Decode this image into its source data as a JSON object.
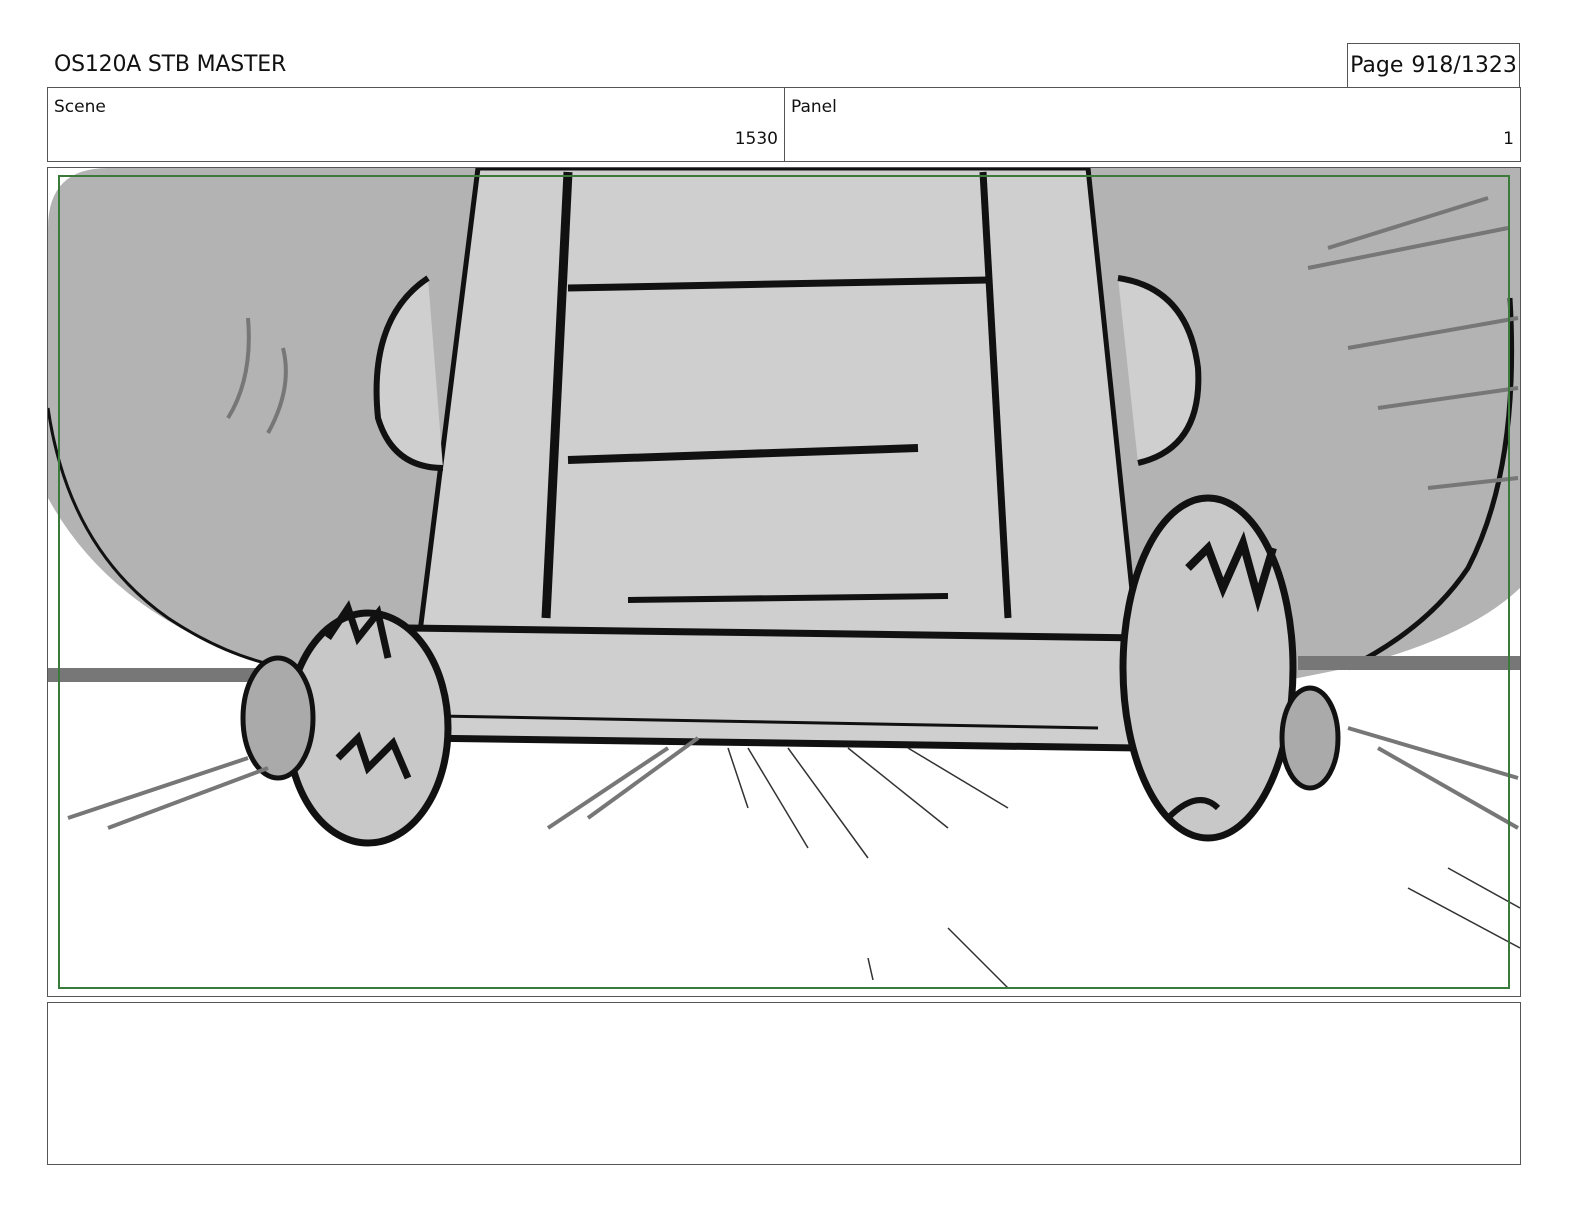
{
  "header": {
    "title": "OS120A STB MASTER",
    "page_label": "Page",
    "page_number": "918/1323"
  },
  "info": {
    "scene_label": "Scene",
    "scene_value": "1530",
    "panel_label": "Panel",
    "panel_value": "1"
  },
  "drawing": {
    "description_icon": "storyboard-sketch",
    "safe_frame_color": "#3a7a3a"
  },
  "notes": {
    "text": ""
  }
}
